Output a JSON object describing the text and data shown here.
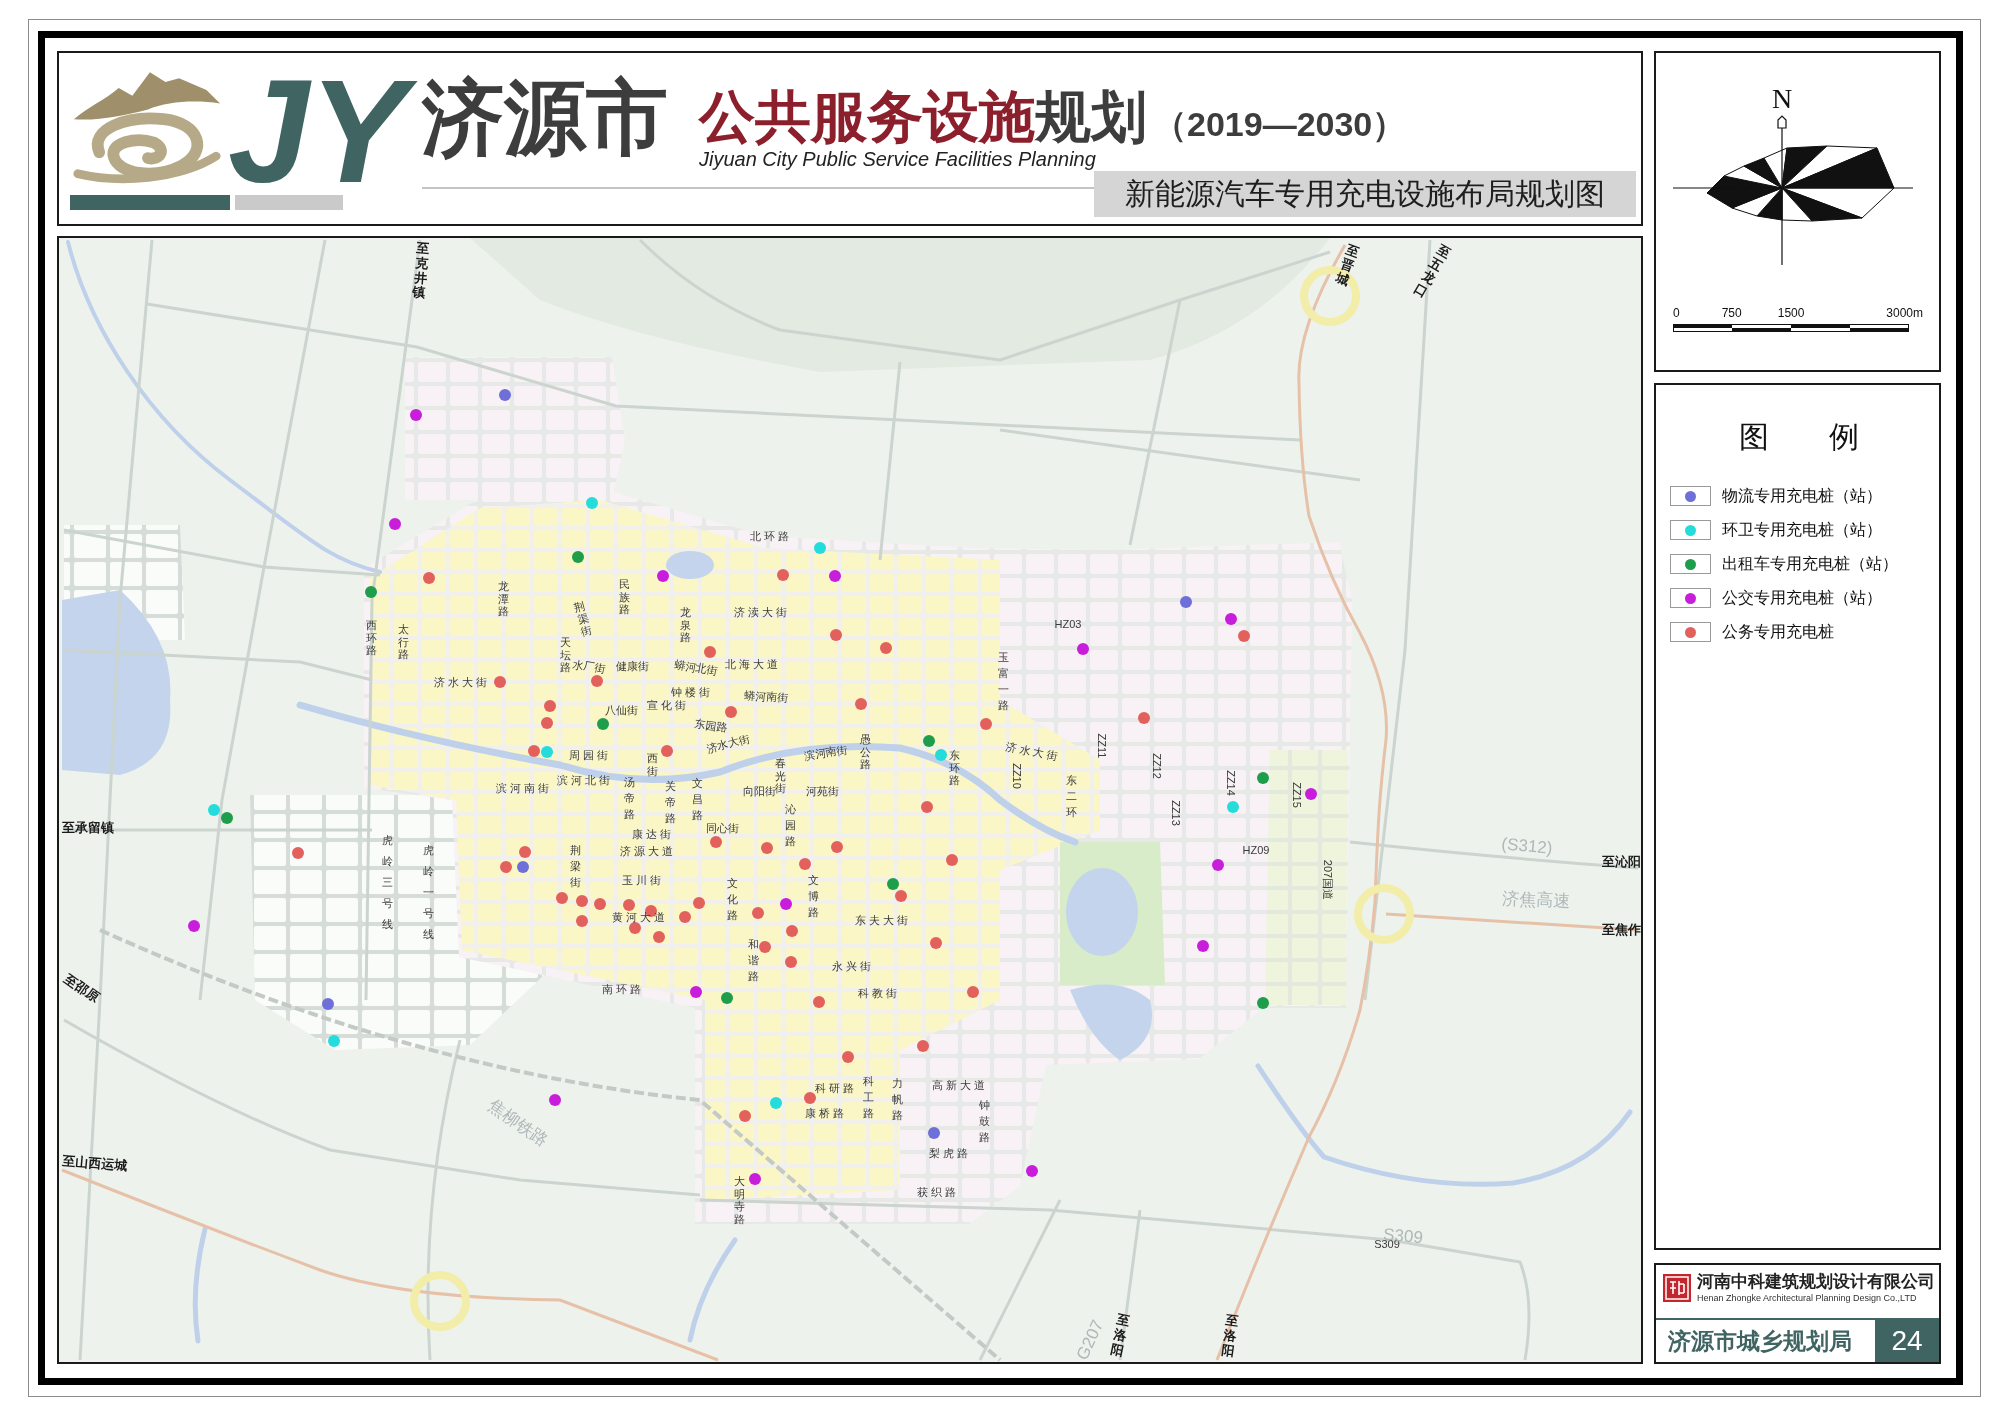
{
  "header": {
    "logo_text": "JY",
    "title_city": "济源市",
    "title_topic": "公共服务设施",
    "title_suffix": "规划",
    "years": "（2019—2030）",
    "subtitle_en": "Jiyuan City Public Service Facilities Planning",
    "map_title": "新能源汽车专用充电设施布局规划图"
  },
  "map": {
    "street_labels": [
      "北环路",
      "龙潭路",
      "西环路",
      "太行路",
      "荆渠街",
      "民族路",
      "龙泉路",
      "济渎大街",
      "天坛路",
      "水厂街",
      "健康街",
      "蟒河北街",
      "北海大道",
      "济水大街",
      "钟楼街",
      "八仙街",
      "宣化街",
      "蟒河南街",
      "玉富一路",
      "东园路",
      "周园街",
      "西街",
      "济水大街",
      "春光街",
      "滨河南街",
      "愚公路",
      "东环路",
      "济水大街",
      "滨河南街",
      "滨河北街",
      "汤帝路",
      "关帝路",
      "文昌路",
      "向阳街",
      "河苑街",
      "康达街",
      "同心街",
      "沁园路",
      "东二环",
      "虎岭三号线",
      "虎岭一号线",
      "荆梁街",
      "济源大道",
      "玉川街",
      "黄河大道",
      "文化路",
      "文博路",
      "东夫大街",
      "和谐路",
      "永兴街",
      "南环路",
      "科教街",
      "科研路",
      "科工路",
      "力帆路",
      "高新大道",
      "康桥路",
      "钟鼓路",
      "梨虎路",
      "大明寺路",
      "获织路"
    ],
    "road_codes": [
      "HZ03",
      "ZZ11",
      "ZZ10",
      "ZZ12",
      "ZZ14",
      "ZZ13",
      "ZZ15",
      "HZ09",
      "207国道",
      "S309"
    ],
    "destination_labels": [
      "至克井镇",
      "至晋城",
      "至五龙口",
      "至承留镇",
      "至沁阳",
      "至焦作",
      "至邵原",
      "至山西运城",
      "至洛阳",
      "至洛阳"
    ],
    "route_labels": [
      "(S312)",
      "济焦高速",
      "焦柳铁路",
      "S309",
      "G207"
    ],
    "stations": [
      {
        "color": "#6f6fd9"
      },
      {
        "color": "#6f6fd9"
      },
      {
        "color": "#6f6fd9"
      },
      {
        "color": "#6f6fd9"
      },
      {
        "color": "#6f6fd9"
      },
      {
        "color": "#25dcdc"
      },
      {
        "color": "#25dcdc"
      },
      {
        "color": "#25dcdc"
      },
      {
        "color": "#25dcdc"
      },
      {
        "color": "#25dcdc"
      },
      {
        "color": "#25dcdc"
      },
      {
        "color": "#25dcdc"
      },
      {
        "color": "#25dcdc"
      },
      {
        "color": "#1e9e4b"
      },
      {
        "color": "#1e9e4b"
      },
      {
        "color": "#1e9e4b"
      },
      {
        "color": "#1e9e4b"
      },
      {
        "color": "#1e9e4b"
      },
      {
        "color": "#1e9e4b"
      },
      {
        "color": "#1e9e4b"
      },
      {
        "color": "#1e9e4b"
      },
      {
        "color": "#1e9e4b"
      },
      {
        "color": "#c81edc"
      },
      {
        "color": "#c81edc"
      },
      {
        "color": "#c81edc"
      },
      {
        "color": "#c81edc"
      },
      {
        "color": "#c81edc"
      },
      {
        "color": "#c81edc"
      },
      {
        "color": "#c81edc"
      },
      {
        "color": "#c81edc"
      },
      {
        "color": "#c81edc"
      },
      {
        "color": "#c81edc"
      },
      {
        "color": "#c81edc"
      },
      {
        "color": "#c81edc"
      },
      {
        "color": "#c81edc"
      },
      {
        "color": "#c81edc"
      },
      {
        "color": "#c81edc"
      },
      {
        "color": "#e2615d"
      },
      {
        "color": "#e2615d"
      },
      {
        "color": "#e2615d"
      },
      {
        "color": "#e2615d"
      },
      {
        "color": "#e2615d"
      },
      {
        "color": "#e2615d"
      },
      {
        "color": "#e2615d"
      },
      {
        "color": "#e2615d"
      },
      {
        "color": "#e2615d"
      },
      {
        "color": "#e2615d"
      },
      {
        "color": "#e2615d"
      },
      {
        "color": "#e2615d"
      },
      {
        "color": "#e2615d"
      },
      {
        "color": "#e2615d"
      },
      {
        "color": "#e2615d"
      },
      {
        "color": "#e2615d"
      },
      {
        "color": "#e2615d"
      },
      {
        "color": "#e2615d"
      },
      {
        "color": "#e2615d"
      },
      {
        "color": "#e2615d"
      },
      {
        "color": "#e2615d"
      },
      {
        "color": "#e2615d"
      },
      {
        "color": "#e2615d"
      },
      {
        "color": "#e2615d"
      },
      {
        "color": "#e2615d"
      },
      {
        "color": "#e2615d"
      },
      {
        "color": "#e2615d"
      },
      {
        "color": "#e2615d"
      },
      {
        "color": "#e2615d"
      },
      {
        "color": "#e2615d"
      },
      {
        "color": "#e2615d"
      },
      {
        "color": "#e2615d"
      },
      {
        "color": "#e2615d"
      },
      {
        "color": "#e2615d"
      },
      {
        "color": "#e2615d"
      },
      {
        "color": "#e2615d"
      },
      {
        "color": "#e2615d"
      },
      {
        "color": "#e2615d"
      },
      {
        "color": "#e2615d"
      },
      {
        "color": "#e2615d"
      },
      {
        "color": "#e2615d"
      },
      {
        "color": "#e2615d"
      },
      {
        "color": "#e2615d"
      },
      {
        "color": "#e2615d"
      },
      {
        "color": "#e2615d"
      },
      {
        "color": "#e2615d"
      },
      {
        "color": "#e2615d"
      }
    ]
  },
  "compass": {
    "north_label": "N",
    "scale_labels": [
      "0",
      "750",
      "1500",
      "3000m"
    ]
  },
  "legend": {
    "title": "图 例",
    "items": [
      {
        "label": "物流专用充电桩（站）",
        "color": "#6f6fd9"
      },
      {
        "label": "环卫专用充电桩（站）",
        "color": "#25dcdc"
      },
      {
        "label": "出租车专用充电桩（站）",
        "color": "#1e9e4b"
      },
      {
        "label": "公交专用充电桩（站）",
        "color": "#c81edc"
      },
      {
        "label": "公务专用充电桩",
        "color": "#e2615d"
      }
    ]
  },
  "company": {
    "name": "河南中科建筑规划设计有限公司",
    "name_en": "Henan Zhongke Architectural Planning Design Co.,LTD",
    "client": "济源市城乡规划局",
    "page_number": "24"
  }
}
